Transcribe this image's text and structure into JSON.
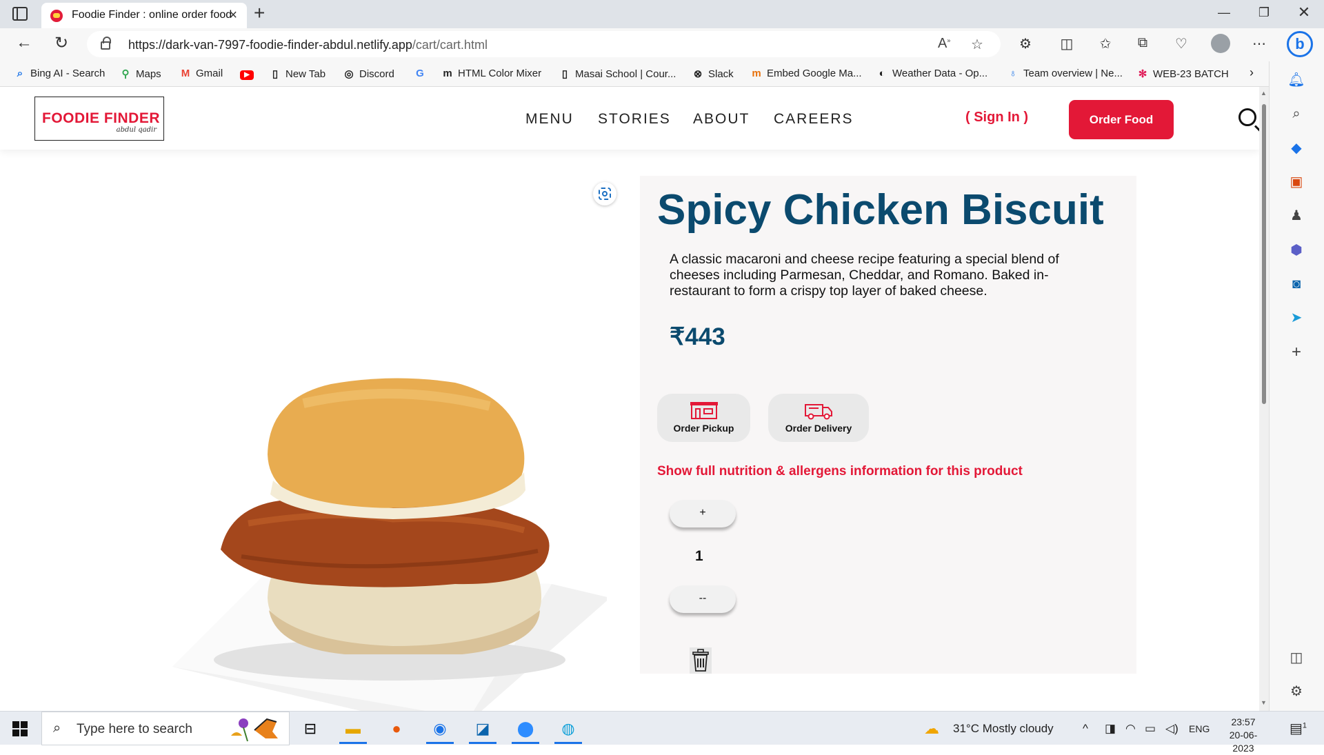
{
  "browser": {
    "tab_title": "Foodie Finder : online order food",
    "new_tab_symbol": "+",
    "url_host": "https://dark-van-7997-foodie-finder-abdul.netlify.app",
    "url_path": "/cart/cart.html",
    "window_controls": [
      "minimize-icon",
      "restore-icon",
      "close-icon"
    ],
    "bookmarks": [
      {
        "label": "Bing AI - Search",
        "icon": "search-icon"
      },
      {
        "label": "Maps",
        "icon": "maps-icon"
      },
      {
        "label": "Gmail",
        "icon": "gmail-icon"
      },
      {
        "label": "",
        "icon": "youtube-icon"
      },
      {
        "label": "New Tab",
        "icon": "page-icon"
      },
      {
        "label": "Discord",
        "icon": "discord-icon"
      },
      {
        "label": "",
        "icon": "google-icon"
      },
      {
        "label": "HTML Color Mixer",
        "icon": "m-icon"
      },
      {
        "label": "Masai School | Cour...",
        "icon": "page-icon"
      },
      {
        "label": "Slack",
        "icon": "slack-icon"
      },
      {
        "label": "Embed Google Ma...",
        "icon": "m-icon"
      },
      {
        "label": "Weather Data - Op...",
        "icon": "weather-icon"
      },
      {
        "label": "Team overview | Ne...",
        "icon": "team-icon"
      },
      {
        "label": "WEB-23 BATCH",
        "icon": "slack-icon"
      }
    ]
  },
  "site": {
    "logo_text": "FOODIE FINDER",
    "logo_signature": "abdul qadir",
    "nav": [
      "MENU",
      "STORIES",
      "ABOUT",
      "CAREERS"
    ],
    "sign_in": "( Sign In )",
    "order_button": "Order Food"
  },
  "product": {
    "title": "Spicy Chicken Biscuit",
    "description": "A classic macaroni and cheese recipe featuring a special blend of cheeses including Parmesan, Cheddar, and Romano. Baked in-restaurant to form a crispy top layer of baked cheese.",
    "price": "₹443",
    "options": [
      {
        "label": "Order Pickup",
        "icon": "pickup-store-icon"
      },
      {
        "label": "Order Delivery",
        "icon": "delivery-truck-icon"
      }
    ],
    "nutrition_link": "Show full nutrition & allergens information for this product",
    "increment_label": "+",
    "decrement_label": "--",
    "quantity": "1"
  },
  "taskbar": {
    "search_placeholder": "Type here to search",
    "weather": "31°C  Mostly cloudy",
    "language": "ENG",
    "time": "23:57",
    "date": "20-06-2023",
    "notification_count": "1"
  },
  "colors": {
    "brand_red": "#e31837",
    "title_blue": "#0b4a6e",
    "panel_bg": "#f8f6f6"
  }
}
